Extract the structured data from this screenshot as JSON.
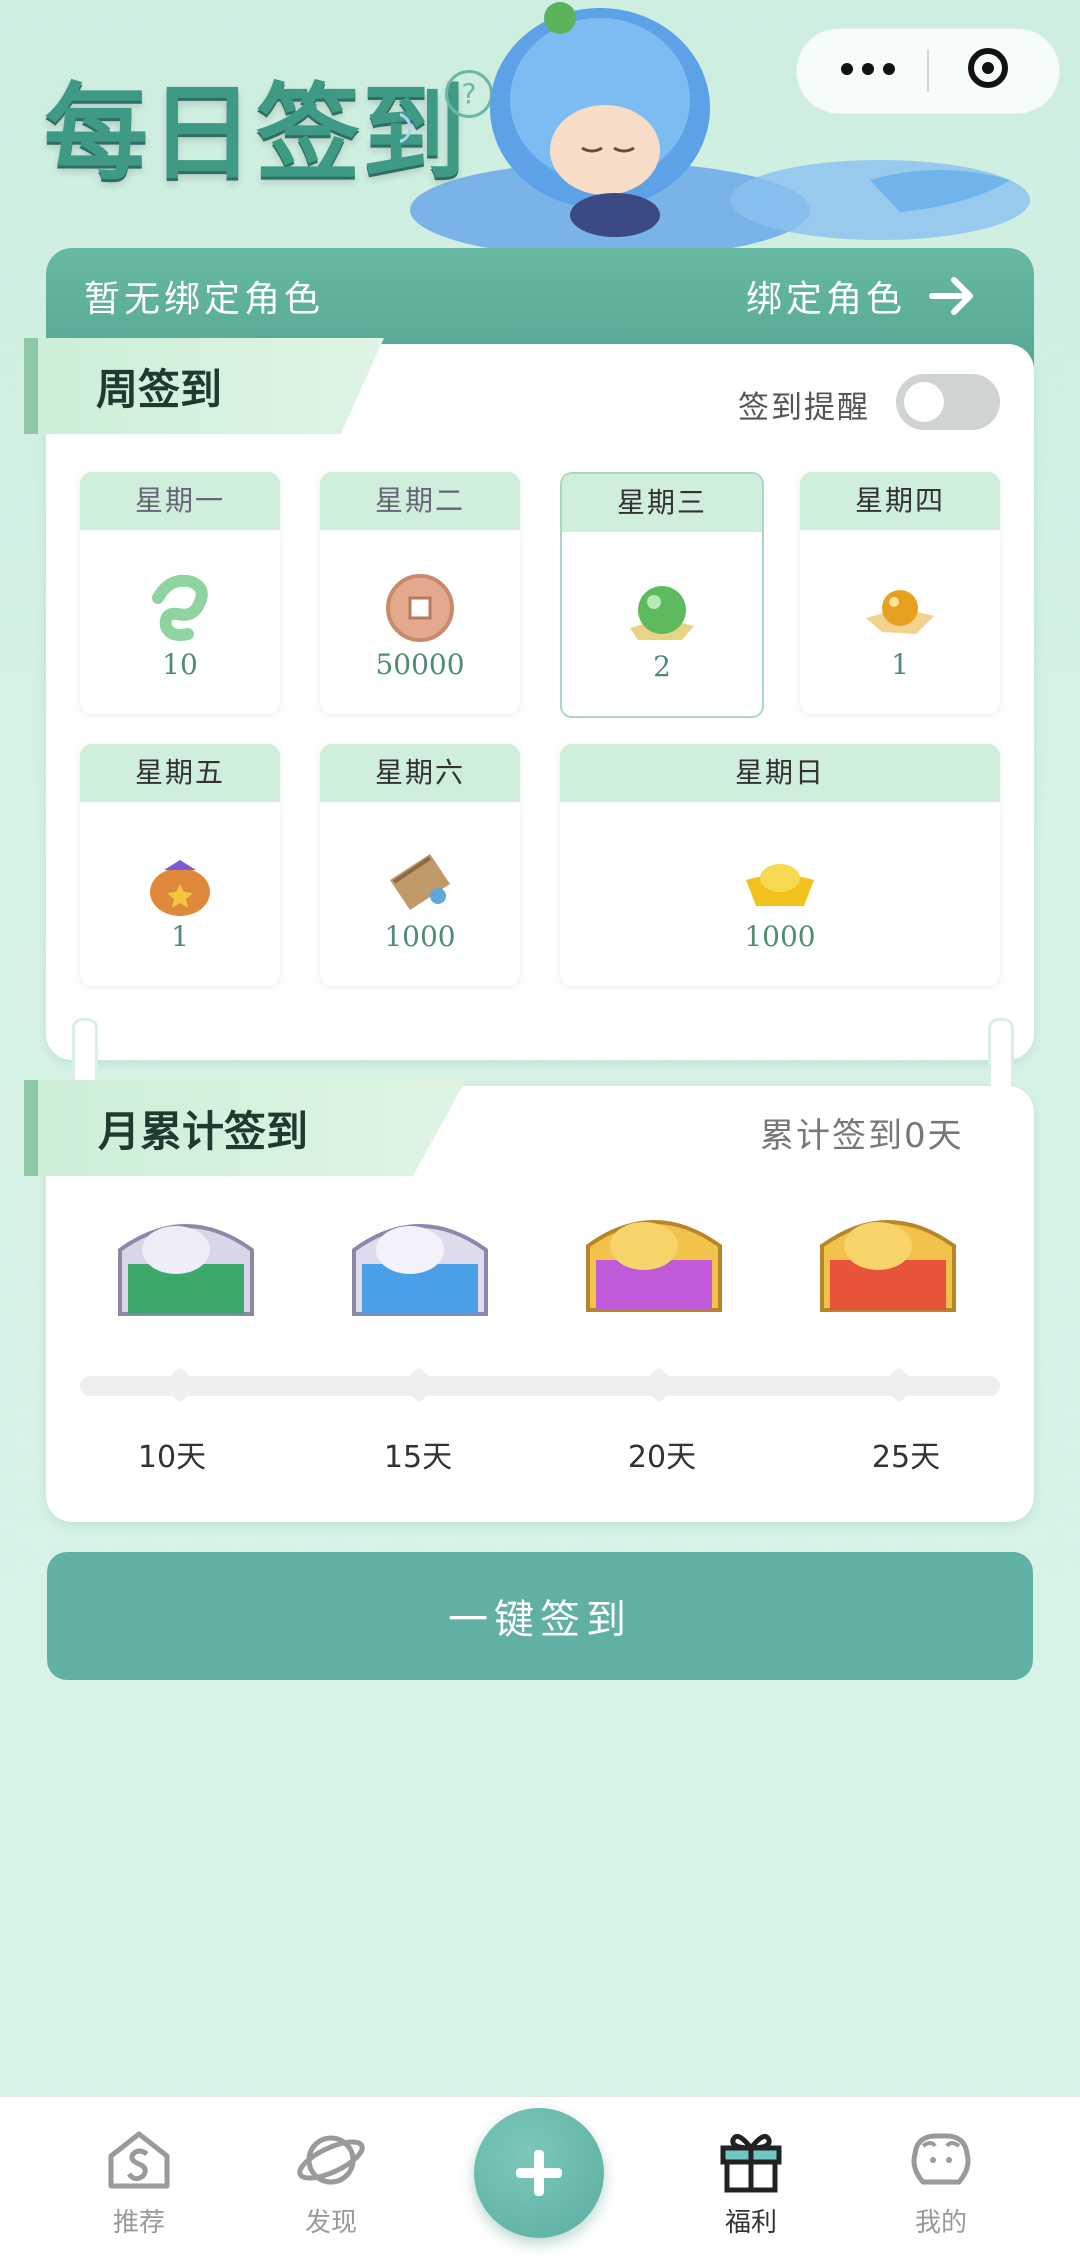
{
  "header": {
    "title": "每日签到",
    "help_symbol": "?"
  },
  "bind": {
    "status": "暂无绑定角色",
    "action": "绑定角色"
  },
  "weekly": {
    "title": "周签到",
    "reminder_label": "签到提醒",
    "reminder_on": false,
    "days": [
      {
        "label": "星期一",
        "value": "10",
        "icon": "green-dragon-icon"
      },
      {
        "label": "星期二",
        "value": "50000",
        "icon": "copper-coin-icon"
      },
      {
        "label": "星期三",
        "value": "2",
        "icon": "jade-orb-icon"
      },
      {
        "label": "星期四",
        "value": "1",
        "icon": "golden-pearl-icon"
      },
      {
        "label": "星期五",
        "value": "1",
        "icon": "treasure-bag-icon"
      },
      {
        "label": "星期六",
        "value": "1000",
        "icon": "scroll-icon"
      },
      {
        "label": "星期日",
        "value": "1000",
        "icon": "gold-ingot-icon"
      }
    ]
  },
  "monthly": {
    "title": "月累计签到",
    "count_text": "累计签到0天",
    "progress": 0,
    "milestones": [
      {
        "label": "10天",
        "chest": "green-chest-icon"
      },
      {
        "label": "15天",
        "chest": "blue-chest-icon"
      },
      {
        "label": "20天",
        "chest": "purple-chest-icon"
      },
      {
        "label": "25天",
        "chest": "red-chest-icon"
      }
    ]
  },
  "signin_button": "一键签到",
  "tabs": [
    {
      "label": "推荐",
      "icon": "home-s-icon"
    },
    {
      "label": "发现",
      "icon": "planet-icon"
    },
    {
      "label": "福利",
      "icon": "gift-icon",
      "active": true
    },
    {
      "label": "我的",
      "icon": "sheep-face-icon"
    }
  ],
  "colors": {
    "accent": "#60b0a4",
    "title": "#3e9a85",
    "ribbon": "#cdeed8"
  }
}
